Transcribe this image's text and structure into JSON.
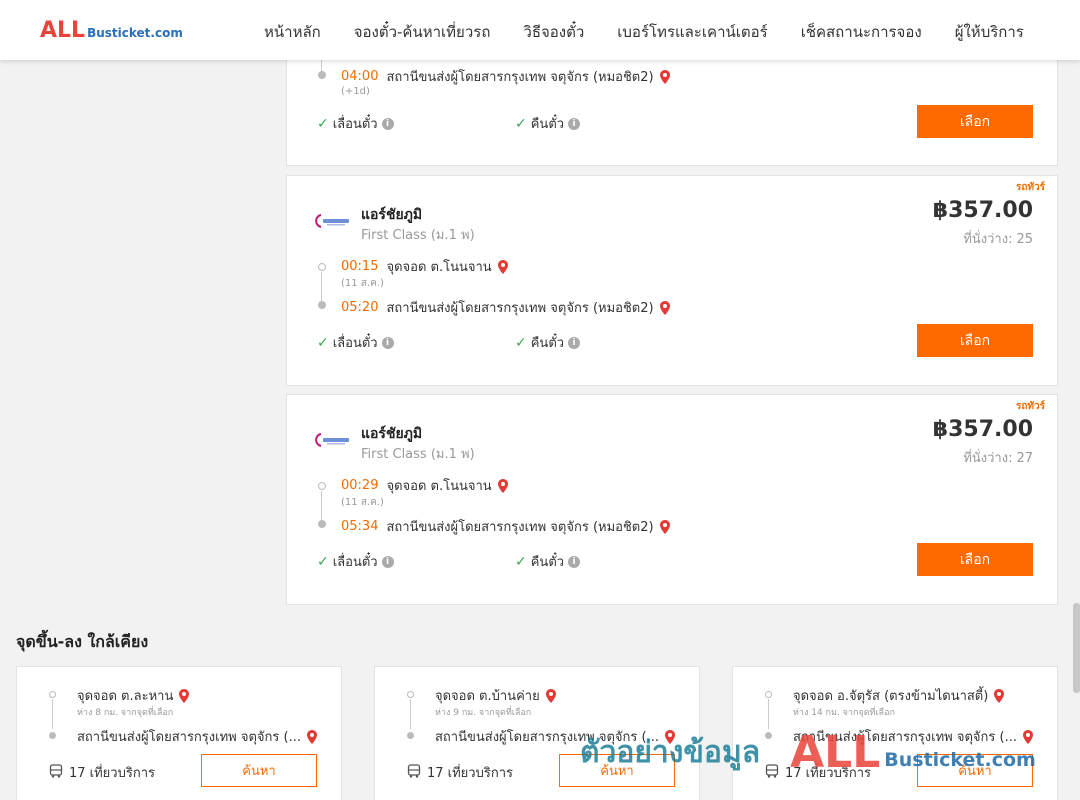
{
  "header": {
    "logo_all": "ALL",
    "logo_rest": "Busticket.com",
    "nav": [
      "หน้าหลัก",
      "จองตั๋ว-ค้นหาเที่ยวรถ",
      "วิธีจองตั๋ว",
      "เบอร์โทรและเคาน์เตอร์",
      "เช็คสถานะการจอง",
      "ผู้ให้บริการ"
    ]
  },
  "trip0": {
    "arrive_time": "04:00",
    "arrive_place": "สถานีขนส่งผู้โดยสารกรุงเทพ จตุจักร (หมอชิต2)",
    "arrive_note": "(+1d)",
    "feature_postpone": "เลื่อนตั๋ว",
    "feature_refund": "คืนตั๋ว",
    "select_label": "เลือก"
  },
  "trip1": {
    "tag": "รถทัวร์",
    "operator": "แอร์ชัยภูมิ",
    "class": "First Class (ม.1 พ)",
    "price": "฿357.00",
    "seats_label": "ที่นั่งว่าง:",
    "seats": "25",
    "depart_time": "00:15",
    "depart_place": "จุดจอด ต.โนนจาน",
    "depart_date": "(11 ส.ค.)",
    "arrive_time": "05:20",
    "arrive_place": "สถานีขนส่งผู้โดยสารกรุงเทพ จตุจักร (หมอชิต2)",
    "feature_postpone": "เลื่อนตั๋ว",
    "feature_refund": "คืนตั๋ว",
    "select_label": "เลือก"
  },
  "trip2": {
    "tag": "รถทัวร์",
    "operator": "แอร์ชัยภูมิ",
    "class": "First Class (ม.1 พ)",
    "price": "฿357.00",
    "seats_label": "ที่นั่งว่าง:",
    "seats": "27",
    "depart_time": "00:29",
    "depart_place": "จุดจอด ต.โนนจาน",
    "depart_date": "(11 ส.ค.)",
    "arrive_time": "05:34",
    "arrive_place": "สถานีขนส่งผู้โดยสารกรุงเทพ จตุจักร (หมอชิต2)",
    "feature_postpone": "เลื่อนตั๋ว",
    "feature_refund": "คืนตั๋ว",
    "select_label": "เลือก"
  },
  "nearby": {
    "title": "จุดขึ้น-ลง ใกล้เคียง",
    "cards": [
      {
        "from": "จุดจอด ต.ละหาน",
        "distance": "ห่าง 8 กม. จากจุดที่เลือก",
        "to": "สถานีขนส่งผู้โดยสารกรุงเทพ จตุจักร (...",
        "trips": "17 เที่ยวบริการ",
        "search_label": "ค้นหา"
      },
      {
        "from": "จุดจอด ต.บ้านค่าย",
        "distance": "ห่าง 9 กม. จากจุดที่เลือก",
        "to": "สถานีขนส่งผู้โดยสารกรุงเทพ จตุจักร (...",
        "trips": "17 เที่ยวบริการ",
        "search_label": "ค้นหา"
      },
      {
        "from": "จุดจอด อ.จัตุรัส (ตรงข้ามไดนาสตี้)",
        "distance": "ห่าง 14 กม. จากจุดที่เลือก",
        "to": "สถานีขนส่งผู้โดยสารกรุงเทพ จตุจักร (...",
        "trips": "17 เที่ยวบริการ",
        "search_label": "ค้นหา"
      }
    ]
  },
  "watermark": {
    "text": "ตัวอย่างข้อมูล",
    "all": "ALL",
    "busticket": "Busticket.com"
  },
  "colors": {
    "accent": "#ff6a00",
    "time": "#ef6c00",
    "check": "#3aa657",
    "pin": "#e53935"
  }
}
